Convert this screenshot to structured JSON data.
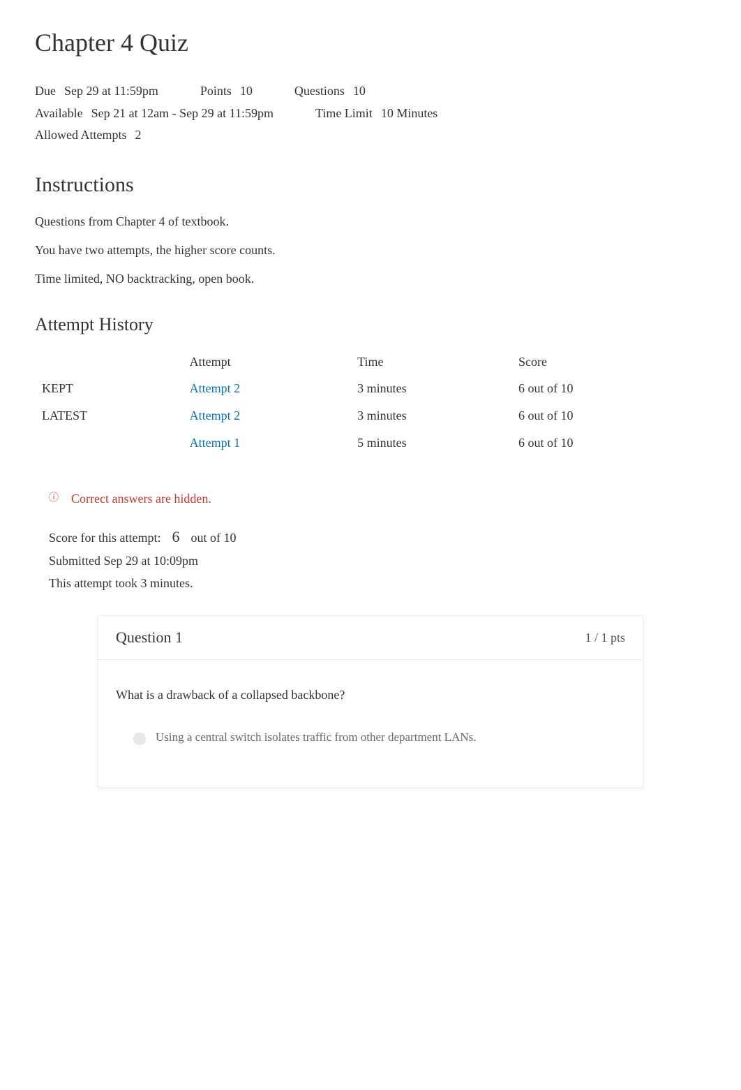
{
  "title": "Chapter 4 Quiz",
  "meta": {
    "due_label": "Due",
    "due_value": "Sep 29 at 11:59pm",
    "points_label": "Points",
    "points_value": "10",
    "questions_label": "Questions",
    "questions_value": "10",
    "available_label": "Available",
    "available_value": "Sep 21 at 12am - Sep 29 at 11:59pm",
    "time_limit_label": "Time Limit",
    "time_limit_value": "10 Minutes",
    "allowed_attempts_label": "Allowed Attempts",
    "allowed_attempts_value": "2"
  },
  "instructions": {
    "heading": "Instructions",
    "lines": [
      "Questions from Chapter 4 of textbook.",
      "You have two attempts, the higher score counts.",
      "Time limited, NO backtracking, open book."
    ]
  },
  "history": {
    "heading": "Attempt History",
    "headers": {
      "status": "",
      "attempt": "Attempt",
      "time": "Time",
      "score": "Score"
    },
    "rows": [
      {
        "status": "KEPT",
        "attempt": "Attempt 2",
        "time": "3 minutes",
        "score": "6 out of 10"
      },
      {
        "status": "LATEST",
        "attempt": "Attempt 2",
        "time": "3 minutes",
        "score": "6 out of 10"
      },
      {
        "status": "",
        "attempt": "Attempt 1",
        "time": "5 minutes",
        "score": "6 out of 10"
      }
    ]
  },
  "hidden_answers": {
    "icon": "ⓘ",
    "text": "Correct answers are hidden."
  },
  "score_summary": {
    "score_label": "Score for this attempt:",
    "score_value": "6",
    "score_suffix": "out of 10",
    "submitted": "Submitted Sep 29 at 10:09pm",
    "duration": "This attempt took 3 minutes."
  },
  "question": {
    "title": "Question 1",
    "points": "1 / 1 pts",
    "prompt": "What is a drawback of a collapsed backbone?",
    "answer": "Using a central switch isolates traffic from other department LANs."
  }
}
